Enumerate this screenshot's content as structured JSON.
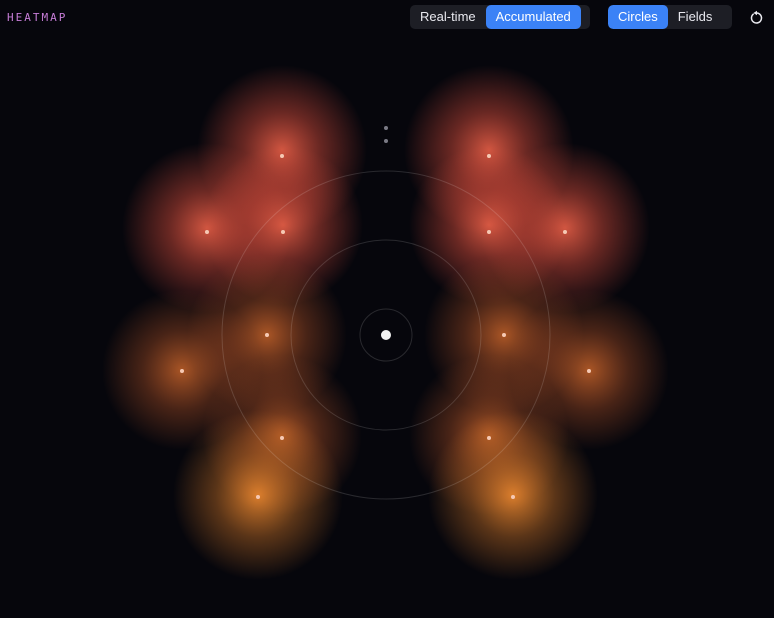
{
  "header": {
    "title": "HEATMAP"
  },
  "view_toggle": {
    "options": [
      "Real-time",
      "Accumulated"
    ],
    "selected": "Accumulated"
  },
  "mode_toggle": {
    "options": [
      "Circles",
      "Fields"
    ],
    "selected": "Circles"
  },
  "reset": {
    "icon": "reset-icon"
  },
  "colors": {
    "background": "#06060c",
    "accent": "#3b82f6",
    "title": "#c77dd8",
    "heat_warm": "#f4644a",
    "heat_hot": "#f08a30"
  }
}
